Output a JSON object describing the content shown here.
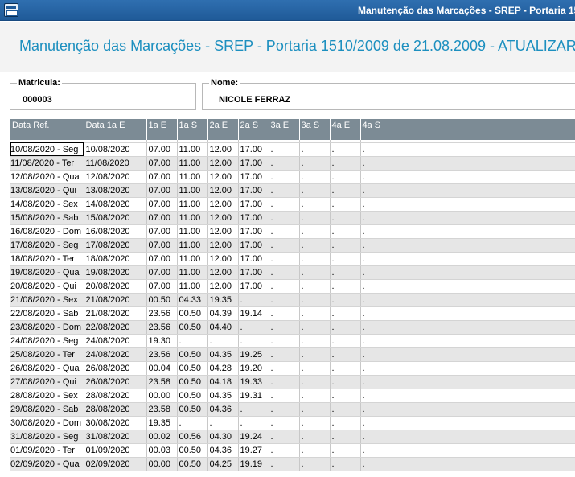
{
  "window": {
    "title": "Manutenção das Marcações - SREP - Portaria 1510/2009 de 21.08.2009 - ATUALIZAR"
  },
  "header": {
    "title": "Manutenção das Marcações - SREP - Portaria 1510/2009 de 21.08.2009 - ATUALIZAR"
  },
  "form": {
    "matricula_label": "Matricula:",
    "matricula_value": "000003",
    "nome_label": "Nome:",
    "nome_value": "NICOLE FERRAZ"
  },
  "grid": {
    "columns": [
      "Data Ref.",
      "Data 1a E",
      "1a E",
      "1a S",
      "2a E",
      "2a S",
      "3a E",
      "3a S",
      "4a E",
      "4a S"
    ],
    "rows": [
      [
        "10/08/2020 - Seg",
        "10/08/2020",
        "07.00",
        "11.00",
        "12.00",
        "17.00",
        ".",
        ".",
        ".",
        "."
      ],
      [
        "11/08/2020 - Ter",
        "11/08/2020",
        "07.00",
        "11.00",
        "12.00",
        "17.00",
        ".",
        ".",
        ".",
        "."
      ],
      [
        "12/08/2020 - Qua",
        "12/08/2020",
        "07.00",
        "11.00",
        "12.00",
        "17.00",
        ".",
        ".",
        ".",
        "."
      ],
      [
        "13/08/2020 - Qui",
        "13/08/2020",
        "07.00",
        "11.00",
        "12.00",
        "17.00",
        ".",
        ".",
        ".",
        "."
      ],
      [
        "14/08/2020 - Sex",
        "14/08/2020",
        "07.00",
        "11.00",
        "12.00",
        "17.00",
        ".",
        ".",
        ".",
        "."
      ],
      [
        "15/08/2020 - Sab",
        "15/08/2020",
        "07.00",
        "11.00",
        "12.00",
        "17.00",
        ".",
        ".",
        ".",
        "."
      ],
      [
        "16/08/2020 - Dom",
        "16/08/2020",
        "07.00",
        "11.00",
        "12.00",
        "17.00",
        ".",
        ".",
        ".",
        "."
      ],
      [
        "17/08/2020 - Seg",
        "17/08/2020",
        "07.00",
        "11.00",
        "12.00",
        "17.00",
        ".",
        ".",
        ".",
        "."
      ],
      [
        "18/08/2020 - Ter",
        "18/08/2020",
        "07.00",
        "11.00",
        "12.00",
        "17.00",
        ".",
        ".",
        ".",
        "."
      ],
      [
        "19/08/2020 - Qua",
        "19/08/2020",
        "07.00",
        "11.00",
        "12.00",
        "17.00",
        ".",
        ".",
        ".",
        "."
      ],
      [
        "20/08/2020 - Qui",
        "20/08/2020",
        "07.00",
        "11.00",
        "12.00",
        "17.00",
        ".",
        ".",
        ".",
        "."
      ],
      [
        "21/08/2020 - Sex",
        "21/08/2020",
        "00.50",
        "04.33",
        "19.35",
        ".",
        ".",
        ".",
        ".",
        "."
      ],
      [
        "22/08/2020 - Sab",
        "21/08/2020",
        "23.56",
        "00.50",
        "04.39",
        "19.14",
        ".",
        ".",
        ".",
        "."
      ],
      [
        "23/08/2020 - Dom",
        "22/08/2020",
        "23.56",
        "00.50",
        "04.40",
        ".",
        ".",
        ".",
        ".",
        "."
      ],
      [
        "24/08/2020 - Seg",
        "24/08/2020",
        "19.30",
        ".",
        ".",
        ".",
        ".",
        ".",
        ".",
        "."
      ],
      [
        "25/08/2020 - Ter",
        "24/08/2020",
        "23.56",
        "00.50",
        "04.35",
        "19.25",
        ".",
        ".",
        ".",
        "."
      ],
      [
        "26/08/2020 - Qua",
        "26/08/2020",
        "00.04",
        "00.50",
        "04.28",
        "19.20",
        ".",
        ".",
        ".",
        "."
      ],
      [
        "27/08/2020 - Qui",
        "26/08/2020",
        "23.58",
        "00.50",
        "04.18",
        "19.33",
        ".",
        ".",
        ".",
        "."
      ],
      [
        "28/08/2020 - Sex",
        "28/08/2020",
        "00.00",
        "00.50",
        "04.35",
        "19.31",
        ".",
        ".",
        ".",
        "."
      ],
      [
        "29/08/2020 - Sab",
        "28/08/2020",
        "23.58",
        "00.50",
        "04.36",
        ".",
        ".",
        ".",
        ".",
        "."
      ],
      [
        "30/08/2020 - Dom",
        "30/08/2020",
        "19.35",
        ".",
        ".",
        ".",
        ".",
        ".",
        ".",
        "."
      ],
      [
        "31/08/2020 - Seg",
        "31/08/2020",
        "00.02",
        "00.56",
        "04.30",
        "19.24",
        ".",
        ".",
        ".",
        "."
      ],
      [
        "01/09/2020 - Ter",
        "01/09/2020",
        "00.03",
        "00.50",
        "04.36",
        "19.27",
        ".",
        ".",
        ".",
        "."
      ],
      [
        "02/09/2020 - Qua",
        "02/09/2020",
        "00.00",
        "00.50",
        "04.25",
        "19.19",
        ".",
        ".",
        ".",
        "."
      ]
    ]
  }
}
